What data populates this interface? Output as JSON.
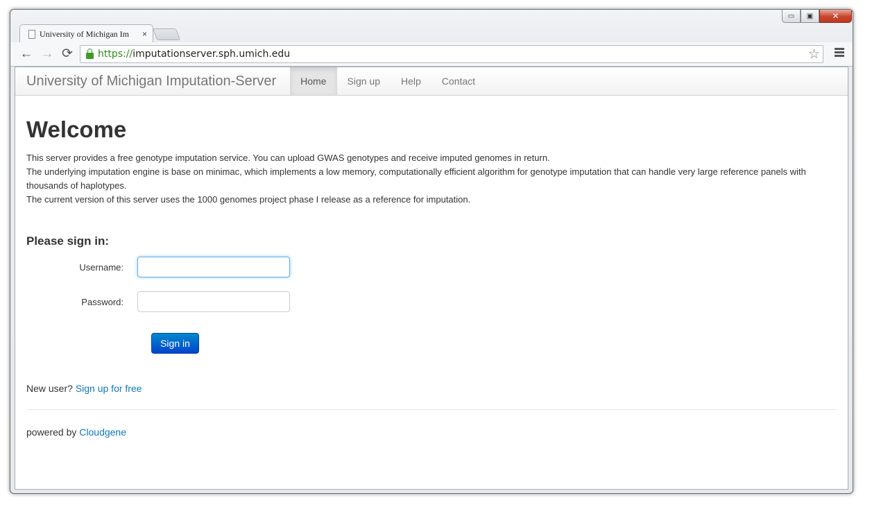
{
  "browser": {
    "tab_title": "University of Michigan Im",
    "tab_close": "×",
    "url_scheme": "https://",
    "url_rest": "imputationserver.sph.umich.edu",
    "window_controls": {
      "minimize": "▭",
      "maximize": "▣",
      "close": "✕"
    }
  },
  "navbar": {
    "brand": "University of Michigan Imputation-Server",
    "items": [
      {
        "label": "Home",
        "active": true
      },
      {
        "label": "Sign up"
      },
      {
        "label": "Help"
      },
      {
        "label": "Contact"
      }
    ]
  },
  "main": {
    "heading": "Welcome",
    "intro_lines": [
      "This server provides a free genotype imputation service. You can upload GWAS genotypes and receive imputed genomes in return.",
      "The underlying imputation engine is base on minimac, which implements a low memory, computationally efficient algorithm for genotype imputation that can handle very large reference panels with thousands of haplotypes.",
      "The current version of this server uses the 1000 genomes project phase I release as a reference for imputation."
    ],
    "signin": {
      "title": "Please sign in:",
      "username_label": "Username:",
      "username_value": "",
      "password_label": "Password:",
      "password_value": "",
      "button": "Sign in"
    },
    "new_user_text": "New user?",
    "signup_link": "Sign up for free",
    "powered_text": "powered by",
    "powered_link": "Cloudgene"
  },
  "colors": {
    "link": "#0d78c2",
    "button_top": "#0088cc",
    "button_bottom": "#0044cc",
    "secure_green": "#2e8b1e"
  }
}
